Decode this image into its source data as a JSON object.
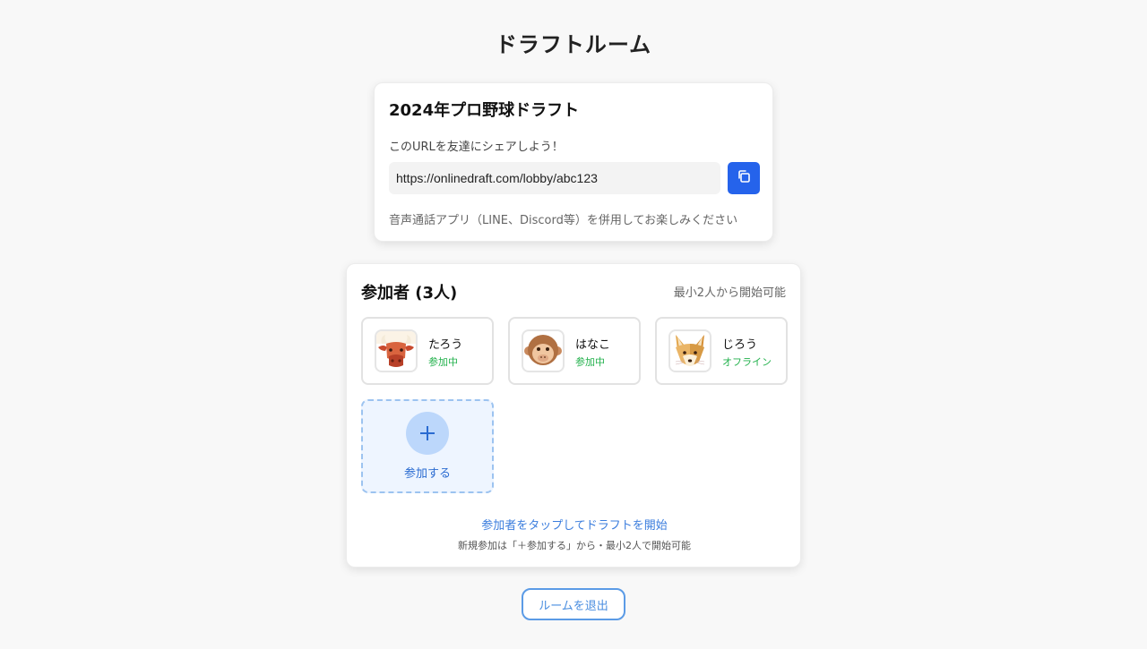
{
  "page": {
    "title": "ドラフトルーム"
  },
  "share": {
    "draft_name": "2024年プロ野球ドラフト",
    "hint": "このURLを友達にシェアしよう！",
    "url": "https://onlinedraft.com/lobby/abc123",
    "copy_icon": "copy-icon",
    "voice_note": "音声通話アプリ（LINE、Discord等）を併用してお楽しみください"
  },
  "participants": {
    "heading": "参加者 (3人)",
    "min_note": "最小2人から開始可能",
    "players": [
      {
        "name": "たろう",
        "status": "参加中",
        "avatar": "ox-icon"
      },
      {
        "name": "はなこ",
        "status": "参加中",
        "avatar": "monkey-icon"
      },
      {
        "name": "じろう",
        "status": "オフライン",
        "avatar": "fox-icon"
      }
    ],
    "join_label": "参加する",
    "start_hint": "参加者をタップしてドラフトを開始",
    "sub_hint": "新規参加は「＋参加する」から・最小2人で開始可能"
  },
  "actions": {
    "leave_label": "ルームを退出"
  },
  "colors": {
    "accent": "#2563eb",
    "status_online": "#22b14c",
    "join_bg": "#eef5ff",
    "join_border": "#9cc3f0"
  }
}
